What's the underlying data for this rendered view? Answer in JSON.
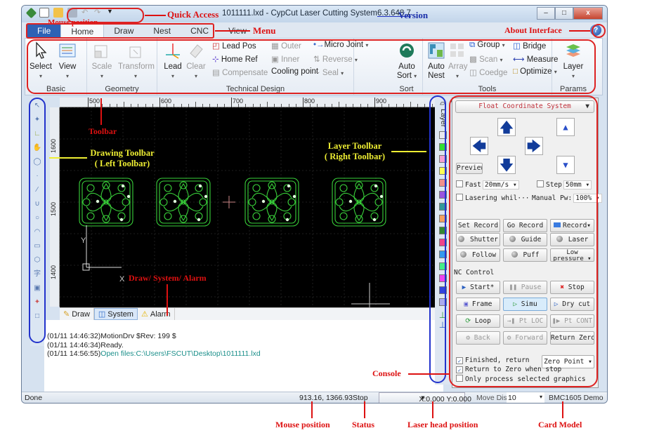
{
  "window": {
    "title_prefix": "1011111.lxd - CypCut Laser Cutting System",
    "version": "6.3.648.7",
    "buttons": {
      "minimize": "–",
      "maximize": "□",
      "close": "x"
    },
    "help_icon": "?"
  },
  "quick_access": {
    "icons": [
      "app-icon",
      "new-file-icon",
      "open-folder-icon",
      "save-icon",
      "undo-icon",
      "redo-icon",
      "customize-icon"
    ]
  },
  "menu": {
    "items": [
      "File",
      "Home",
      "Draw",
      "Nest",
      "CNC",
      "View"
    ],
    "active": "Home"
  },
  "ribbon": {
    "groups": {
      "basic": {
        "label": "Basic",
        "buttons": [
          "Select",
          "View"
        ]
      },
      "geometry": {
        "label": "Geometry",
        "buttons": [
          "Scale",
          "Transform"
        ]
      },
      "technical": {
        "label": "Technical Design",
        "lead": "Lead",
        "clear": "Clear",
        "col1": [
          "Lead Pos",
          "Home Ref",
          "Compensate"
        ],
        "col2": [
          "Outer",
          "Inner",
          "Cooling point"
        ],
        "col3": [
          "Micro Joint",
          "Reverse",
          "Seal"
        ]
      },
      "sort": {
        "label": "Sort",
        "button_line1": "Auto",
        "button_line2": "Sort"
      },
      "tools": {
        "label": "Tools",
        "auto_nest_1": "Auto",
        "auto_nest_2": "Nest",
        "array": "Array",
        "col1": [
          "Group",
          "Scan",
          "Coedge"
        ],
        "col2": [
          "Bridge",
          "Measure",
          "Optimize"
        ]
      },
      "params": {
        "label": "Params",
        "button": "Layer"
      }
    }
  },
  "ruler": {
    "top": [
      "500",
      "600",
      "700",
      "800",
      "900",
      "1000"
    ],
    "left": [
      "1600",
      "1500",
      "1400"
    ]
  },
  "canvas": {
    "axis_x": "X",
    "axis_y": "Y",
    "shape_color": "#39d13a"
  },
  "layer_toolbar": {
    "title": "Layer",
    "colors": [
      "#e8e8f0",
      "#33dd33",
      "#f4a0d0",
      "#ffff55",
      "#f0908a",
      "#9955dd",
      "#339999",
      "#f4a060",
      "#338833",
      "#ee4488",
      "#3399ee",
      "#44ee88",
      "#ee44ee",
      "#3344dd",
      "#aaaaee"
    ]
  },
  "bottom_tabs": [
    "Draw",
    "System",
    "Alarm"
  ],
  "bottom_tab_active": "System",
  "console": {
    "lines": [
      {
        "time": "(01/11 14:46:32)",
        "text": "MotionDrv $Rev: 199 $",
        "style": "normal"
      },
      {
        "time": "(01/11 14:46:34)",
        "text": "Ready.",
        "style": "normal"
      },
      {
        "time": "(01/11 14:56:55)",
        "text": "Open files:C:\\Users\\FSCUT\\Desktop\\1011111.lxd",
        "style": "teal"
      }
    ]
  },
  "panel": {
    "coordinate_system": "Float Coordinate System",
    "preview": "Preview",
    "fast_label": "Fast",
    "fast_value": "20mm/s",
    "step_label": "Step",
    "step_value": "50mm",
    "lasering_label": "Lasering whil···",
    "manual_pw_label": "Manual Pw",
    "manual_pw_value": "100%",
    "buttons_row1": [
      "Set Record",
      "Go Record",
      "Record"
    ],
    "buttons_row2": [
      "Shutter",
      "Guide",
      "Laser"
    ],
    "buttons_row3": [
      "Follow",
      "Puff",
      "Low pressure"
    ],
    "nc_control": "NC Control",
    "nc_row1": [
      "Start*",
      "Pause",
      "Stop"
    ],
    "nc_row2": [
      "Frame",
      "Simu",
      "Dry cut"
    ],
    "nc_row3": [
      "Loop",
      "Pt LOC",
      "Pt CONT"
    ],
    "nc_row4": [
      "Back",
      "Forward",
      "Return Zero"
    ],
    "finished_return": "Finished, return",
    "finished_return_checked": true,
    "zero_point": "Zero Point",
    "return_zero_stop": "Return to Zero when stop",
    "return_zero_stop_checked": true,
    "only_selected": "Only process selected graphics",
    "only_selected_checked": false
  },
  "statusbar": {
    "status_text": "Done",
    "mouse_position": "913.16, 1366.93",
    "machine_status": "Stop",
    "laser_head": "X:0.000 Y:0.000",
    "move_dis_label": "Move Dis",
    "move_dis_value": "10",
    "card_model": "BMC1605 Demo"
  },
  "annotations": {
    "quick_access": "Quick Access",
    "mouse_position_top": "Mouse position",
    "version": "Version",
    "menu": "Menu",
    "about": "About Interface",
    "toolbar": "Toolbar",
    "drawing_toolbar_1": "Drawing Toolbar",
    "drawing_toolbar_2": "( Left Toolbar)",
    "layer_toolbar_1": "Layer Toolbar",
    "layer_toolbar_2": "( Right Toolbar)",
    "draw_system_alarm": "Draw/ System/ Alarm",
    "console": "Console",
    "mouse_position": "Mouse position",
    "status": "Status",
    "laser_head": "Laser head position",
    "card_model": "Card Model"
  }
}
